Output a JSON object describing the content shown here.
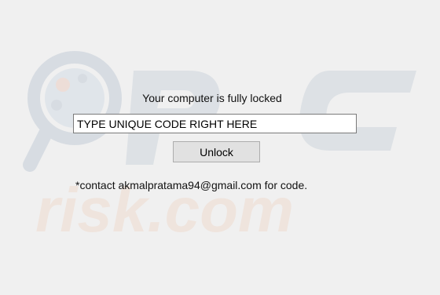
{
  "window": {
    "background": "#f0f0f0"
  },
  "lock_screen": {
    "message": "Your computer is fully locked",
    "code_input": {
      "value": "TYPE UNIQUE CODE RIGHT HERE",
      "placeholder": ""
    },
    "unlock_button_label": "Unlock",
    "contact_note": "*contact akmalpratama94@gmail.com for code."
  },
  "watermark": {
    "text": "PC risk.com",
    "icon": "magnifier-logo-icon"
  }
}
